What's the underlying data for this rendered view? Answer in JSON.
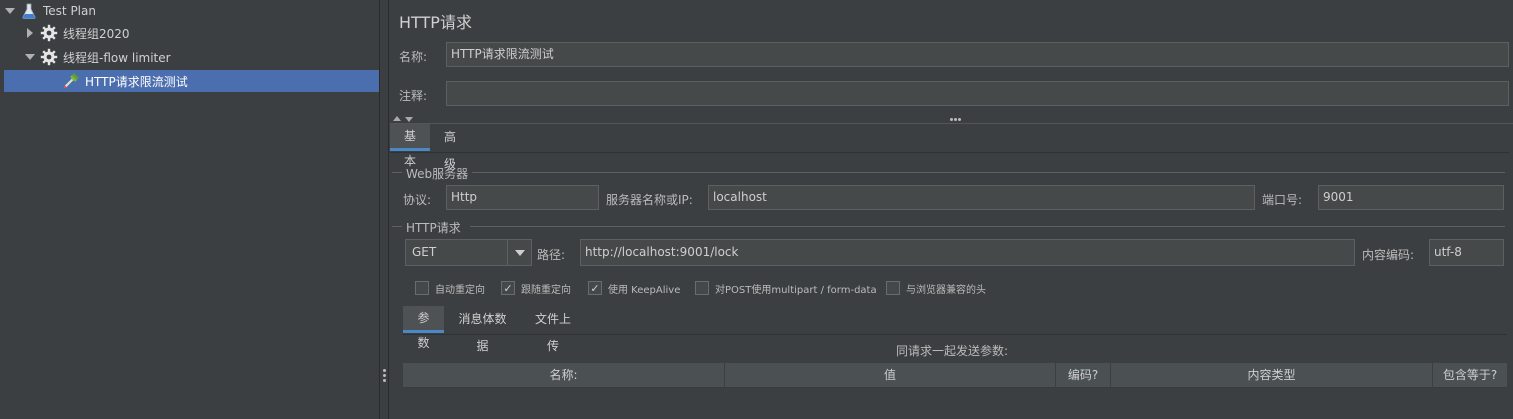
{
  "tree": {
    "items": [
      {
        "label": "Test Plan",
        "icon": "flask-icon"
      },
      {
        "label": "线程组2020",
        "icon": "gear-icon"
      },
      {
        "label": "线程组-flow limiter",
        "icon": "gear-icon"
      },
      {
        "label": "HTTP请求限流测试",
        "icon": "pipette-icon"
      }
    ]
  },
  "main": {
    "title": "HTTP请求",
    "name_label": "名称:",
    "name_value": "HTTP请求限流测试",
    "comment_label": "注释:",
    "comment_value": ""
  },
  "tabs": [
    {
      "label": "基本"
    },
    {
      "label": "高级"
    }
  ],
  "web_server": {
    "group_label": "Web服务器",
    "protocol_label": "协议:",
    "protocol_value": "Http",
    "server_label": "服务器名称或IP:",
    "server_value": "localhost",
    "port_label": "端口号:",
    "port_value": "9001"
  },
  "http_request": {
    "group_label": "HTTP请求",
    "method": "GET",
    "path_label": "路径:",
    "path_value": "http://localhost:9001/lock",
    "encoding_label": "内容编码:",
    "encoding_value": "utf-8"
  },
  "options": [
    {
      "label": "自动重定向",
      "checked": false
    },
    {
      "label": "跟随重定向",
      "checked": true
    },
    {
      "label": "使用 KeepAlive",
      "checked": true
    },
    {
      "label": "对POST使用multipart / form-data",
      "checked": false
    },
    {
      "label": "与浏览器兼容的头",
      "checked": false
    }
  ],
  "sub_tabs": [
    {
      "label": "参数"
    },
    {
      "label": "消息体数据"
    },
    {
      "label": "文件上传"
    }
  ],
  "params": {
    "caption": "同请求一起发送参数:",
    "columns": [
      "名称:",
      "值",
      "编码?",
      "内容类型",
      "包含等于?"
    ]
  },
  "colors": {
    "background": "#3c3f41",
    "selection": "#4b6eaf",
    "field": "#45494a",
    "tab_accent": "#4a88c7"
  }
}
